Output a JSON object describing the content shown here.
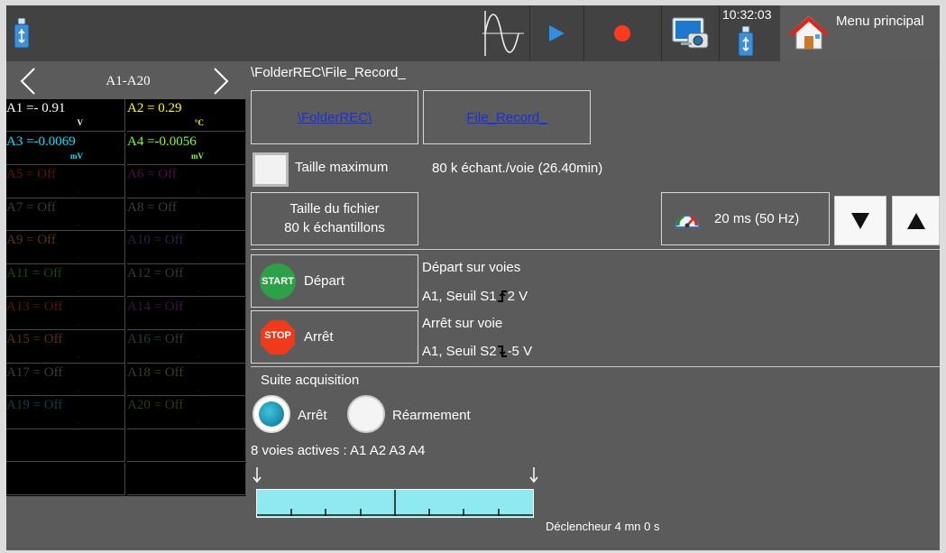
{
  "topbar": {
    "clock": "10:32:03",
    "menu_label": "Menu principal",
    "icons": [
      "usb-icon",
      "waveform-icon",
      "play-icon",
      "record-icon",
      "screenshot-icon",
      "usb-icon",
      "home-icon"
    ],
    "accent_play": "#2f8fe3",
    "accent_record": "#ff3b1f"
  },
  "channel_nav": {
    "label": "A1-A20",
    "prev_icon": "chevron-left-icon",
    "next_icon": "chevron-right-icon"
  },
  "channels": [
    {
      "text": "A1 =-  0.91",
      "unit": "V",
      "color": "#ffffff"
    },
    {
      "text": "A2 =   0.29",
      "unit": "°C",
      "color": "#ffff00"
    },
    {
      "text": "A3 =-0.0069",
      "unit": "mV",
      "color": "#00e5ff"
    },
    {
      "text": "A4 =-0.0056",
      "unit": "mV",
      "color": "#7dff3a"
    },
    {
      "text": "A5 = Off",
      "unit": "-",
      "color": "#5a1414"
    },
    {
      "text": "A6 = Off",
      "unit": "-",
      "color": "#4a1246"
    },
    {
      "text": "A7 = Off",
      "unit": "-",
      "color": "#3c3c1e"
    },
    {
      "text": "A8 = Off",
      "unit": "-",
      "color": "#3c3c3c"
    },
    {
      "text": "A9 = Off",
      "unit": "-",
      "color": "#5a3414"
    },
    {
      "text": "A10 = Off",
      "unit": "-",
      "color": "#1e2a4a"
    },
    {
      "text": "A11 = Off",
      "unit": "-",
      "color": "#0f4a12"
    },
    {
      "text": "A12 = Off",
      "unit": "-",
      "color": "#2e3a3c"
    },
    {
      "text": "A13 = Off",
      "unit": "-",
      "color": "#5a1414"
    },
    {
      "text": "A14 = Off",
      "unit": "-",
      "color": "#3a1446"
    },
    {
      "text": "A15 = Off",
      "unit": "-",
      "color": "#5a3014"
    },
    {
      "text": "A16 = Off",
      "unit": "-",
      "color": "#2e3a3c"
    },
    {
      "text": "A17 = Off",
      "unit": "-",
      "color": "#3c3c3c"
    },
    {
      "text": "A18 = Off",
      "unit": "-",
      "color": "#3c3c1e"
    },
    {
      "text": "A19 = Off",
      "unit": "-",
      "color": "#123e44"
    },
    {
      "text": "A20 = Off",
      "unit": "-",
      "color": "#2e3c14"
    }
  ],
  "record": {
    "path": "\\FolderREC\\File_Record_",
    "folder_button": "\\FolderREC\\",
    "file_button": "File_Record_",
    "max_size_label": "Taille maximum",
    "max_size_info": "80 k échant./voie  (26.40min)",
    "file_size_line1": "Taille du fichier",
    "file_size_line2": "80 k échantillons",
    "sample_rate": "20 ms (50 Hz)",
    "start_badge": "START",
    "start_label": "Départ",
    "start_info_title": "Départ  sur voies",
    "start_info_cond": "A1, Seuil S1",
    "start_info_value": "2 V",
    "stop_badge": "STOP",
    "stop_label": "Arrêt",
    "stop_info_title": "Arrêt sur voie",
    "stop_info_cond": "A1, Seuil S2",
    "stop_info_value": "-5 V",
    "acq_title": "Suite acquisition",
    "radio_stop": "Arrêt",
    "radio_rearm": "Réarmement",
    "radio_selected": "Arrêt",
    "active_channels": "8 voies actives : A1 A2 A3 A4",
    "trigger_text": "Déclencheur 4 mn 0 s"
  }
}
